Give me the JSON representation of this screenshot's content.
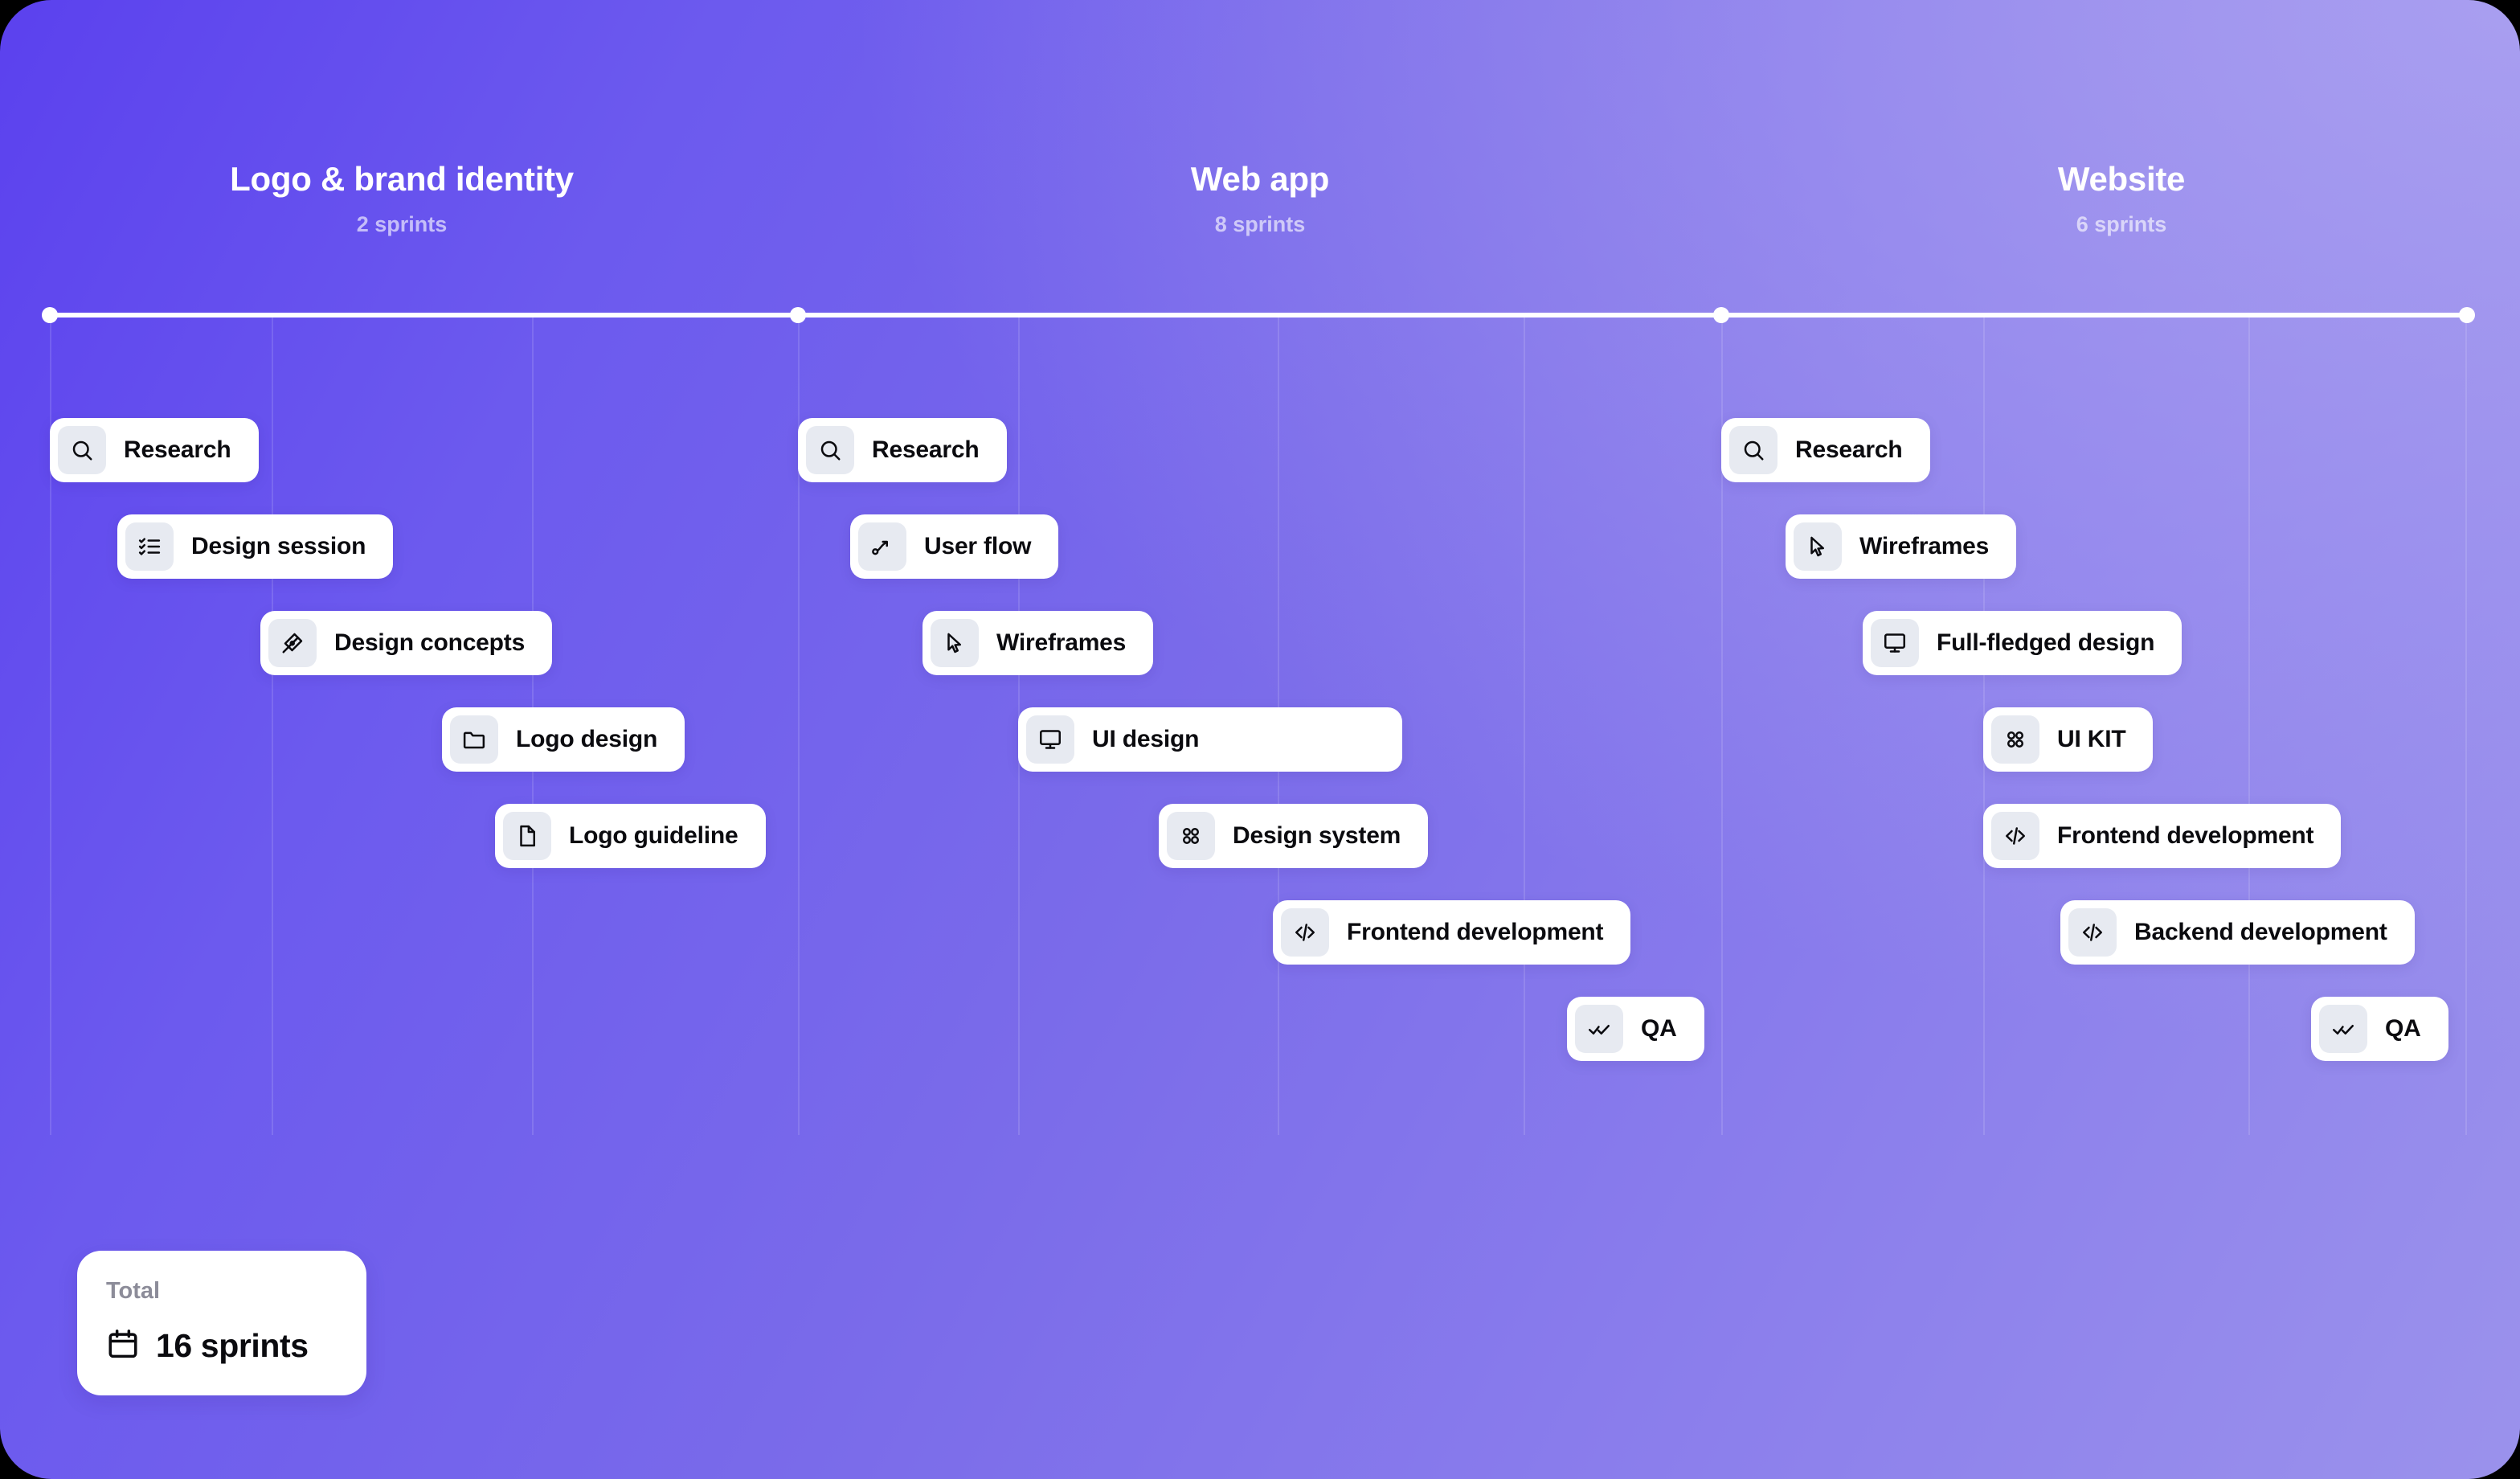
{
  "board": {
    "title": "Project roadmap timeline",
    "accent_color": "#6C5AEE",
    "card_background": "#FFFFFF",
    "chip_background": "#E7EAF1"
  },
  "phases": [
    {
      "name": "Logo & brand identity",
      "sprints_label": "2 sprints",
      "sprints": 2
    },
    {
      "name": "Web app",
      "sprints_label": "8 sprints",
      "sprints": 8
    },
    {
      "name": "Website",
      "sprints_label": "6 sprints",
      "sprints": 6
    }
  ],
  "tasks": {
    "phase1": [
      {
        "label": "Research",
        "icon": "search-icon"
      },
      {
        "label": "Design session",
        "icon": "checklist-icon"
      },
      {
        "label": "Design concepts",
        "icon": "pen-nib-icon"
      },
      {
        "label": "Logo design",
        "icon": "folder-icon"
      },
      {
        "label": "Logo guideline",
        "icon": "file-icon"
      }
    ],
    "phase2": [
      {
        "label": "Research",
        "icon": "search-icon"
      },
      {
        "label": "User flow",
        "icon": "flow-arrow-icon"
      },
      {
        "label": "Wireframes",
        "icon": "cursor-icon"
      },
      {
        "label": "UI design",
        "icon": "monitor-icon"
      },
      {
        "label": "Design system",
        "icon": "grid-dots-icon"
      },
      {
        "label": "Frontend development",
        "icon": "code-icon"
      },
      {
        "label": "QA",
        "icon": "double-check-icon"
      }
    ],
    "phase3": [
      {
        "label": "Research",
        "icon": "search-icon"
      },
      {
        "label": "Wireframes",
        "icon": "cursor-icon"
      },
      {
        "label": "Full-fledged design",
        "icon": "monitor-icon"
      },
      {
        "label": "UI KIT",
        "icon": "grid-dots-icon"
      },
      {
        "label": "Frontend development",
        "icon": "code-icon"
      },
      {
        "label": "Backend development",
        "icon": "code-icon"
      },
      {
        "label": "QA",
        "icon": "double-check-icon"
      }
    ]
  },
  "total": {
    "label": "Total",
    "value": "16 sprints",
    "icon": "calendar-icon"
  }
}
